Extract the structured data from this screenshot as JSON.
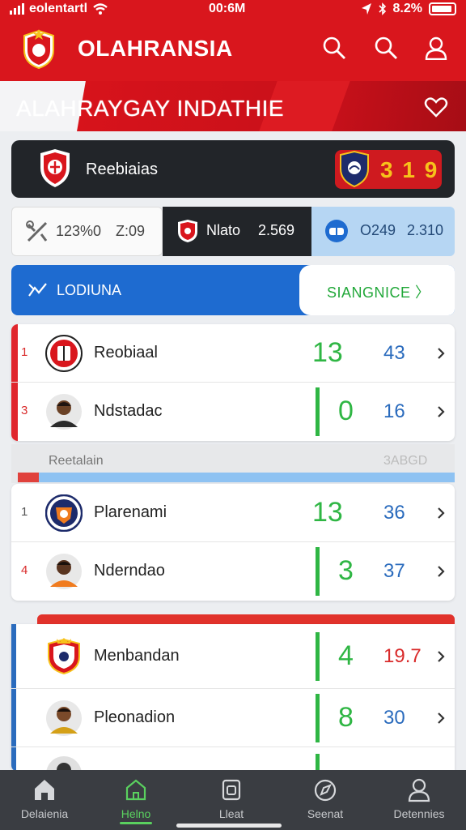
{
  "status_bar": {
    "carrier": "eolentartl",
    "time": "00:6M",
    "battery": "8.2%"
  },
  "header": {
    "app_title": "OLAHRANSIA",
    "icons": [
      "search-icon",
      "search-icon",
      "profile-icon"
    ]
  },
  "banner": {
    "title": "ALAHRAYGAY INDATHIE"
  },
  "featured_match": {
    "team_name": "Reebiaias",
    "score": "3 1 9"
  },
  "segments": [
    {
      "label": "123%0",
      "value": "Z:09"
    },
    {
      "label": "Nlato",
      "value": "2.569"
    },
    {
      "label": "O249",
      "value": "2.310"
    }
  ],
  "tabs": {
    "left_label": "LODIUNA",
    "right_label": "SIANGNICE 〉"
  },
  "group1": [
    {
      "rank": "1",
      "name": "Reobiaal",
      "value1": "13",
      "value2": "43",
      "accent": "#e0262d",
      "rank_color": "#d92b2b"
    },
    {
      "rank": "3",
      "name": "Ndstadac",
      "value1": "0",
      "value2": "16",
      "accent": "#e0262d",
      "rank_color": "#d92b2b"
    }
  ],
  "subsection": {
    "label": "Reetalain",
    "right_text": "3ABGD"
  },
  "group2": [
    {
      "rank": "1",
      "name": "Plarenami",
      "value1": "13",
      "value2": "36",
      "rank_color": "#555555"
    },
    {
      "rank": "4",
      "name": "Nderndao",
      "value1": "3",
      "value2": "37",
      "rank_color": "#d92b2b"
    }
  ],
  "group3": [
    {
      "rank": "",
      "name": "Menbandan",
      "value1": "4",
      "value2": "19.7",
      "value2_color": "#d92b2b",
      "accent": "#2a6bbd"
    },
    {
      "rank": "",
      "name": "Pleonadion",
      "value1": "8",
      "value2": "30",
      "value2_color": "#2a6bbd",
      "accent": "#2a6bbd"
    }
  ],
  "bottom_nav": [
    {
      "label": "Delaienia",
      "icon": "home-icon"
    },
    {
      "label": "Helno",
      "icon": "house-outline-icon"
    },
    {
      "label": "Lleat",
      "icon": "square-icon"
    },
    {
      "label": "Seenat",
      "icon": "compass-icon"
    },
    {
      "label": "Detennies",
      "icon": "profile-icon"
    }
  ],
  "colors": {
    "brand_red": "#d9161d",
    "accent_blue": "#1e6bd0",
    "positive_green": "#2fb644",
    "gold": "#f7c21b"
  }
}
